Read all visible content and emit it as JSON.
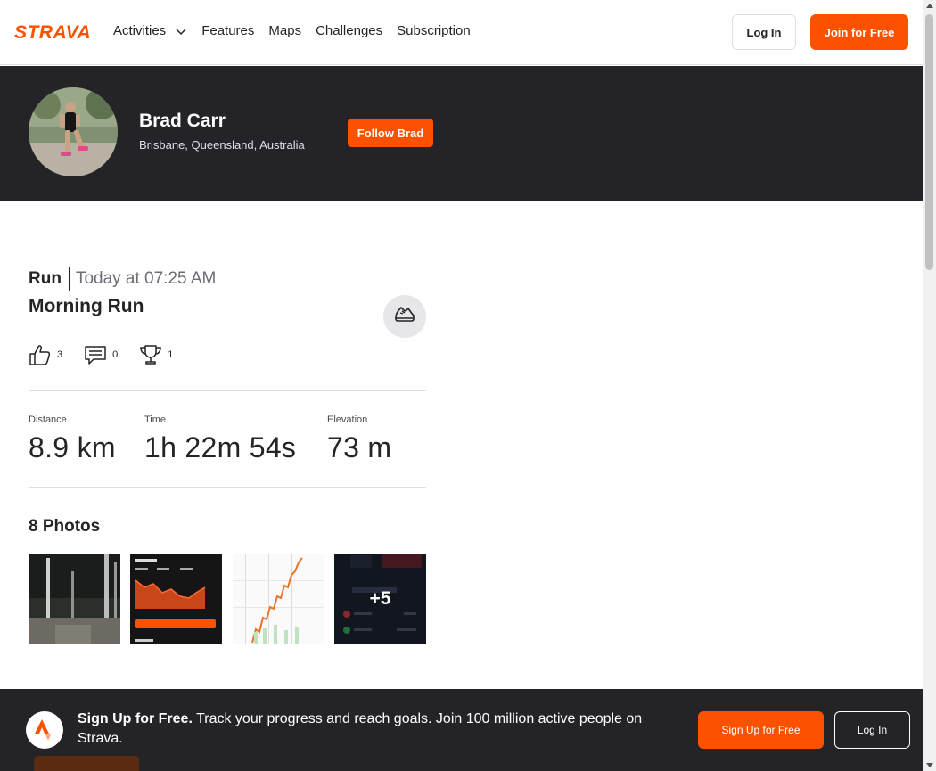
{
  "nav": {
    "logo_text": "STRAVA",
    "links": [
      {
        "label": "Activities",
        "has_dropdown": true
      },
      {
        "label": "Features"
      },
      {
        "label": "Maps"
      },
      {
        "label": "Challenges"
      },
      {
        "label": "Subscription"
      }
    ],
    "login_label": "Log In",
    "join_label": "Join for Free"
  },
  "athlete": {
    "name": "Brad Carr",
    "location": "Brisbane, Queensland, Australia",
    "follow_label": "Follow Brad"
  },
  "activity": {
    "type": "Run",
    "time": "Today at 07:25 AM",
    "title": "Morning Run",
    "gear_icon": "running-shoe-icon",
    "kudos_count": "3",
    "comments_count": "0",
    "achievements_count": "1",
    "stats": [
      {
        "label": "Distance",
        "value": "8.9 km"
      },
      {
        "label": "Time",
        "value": "1h 22m 54s"
      },
      {
        "label": "Elevation",
        "value": "73 m"
      }
    ]
  },
  "photos": {
    "heading": "8 Photos",
    "more_label": "+5"
  },
  "banner": {
    "bold": "Sign Up for Free.",
    "text": " Track your progress and reach goals. Join 100 million active people on Strava.",
    "signup_label": "Sign Up for Free",
    "login_label": "Log In"
  },
  "colors": {
    "brand": "#fc5200",
    "dark": "#242428"
  }
}
